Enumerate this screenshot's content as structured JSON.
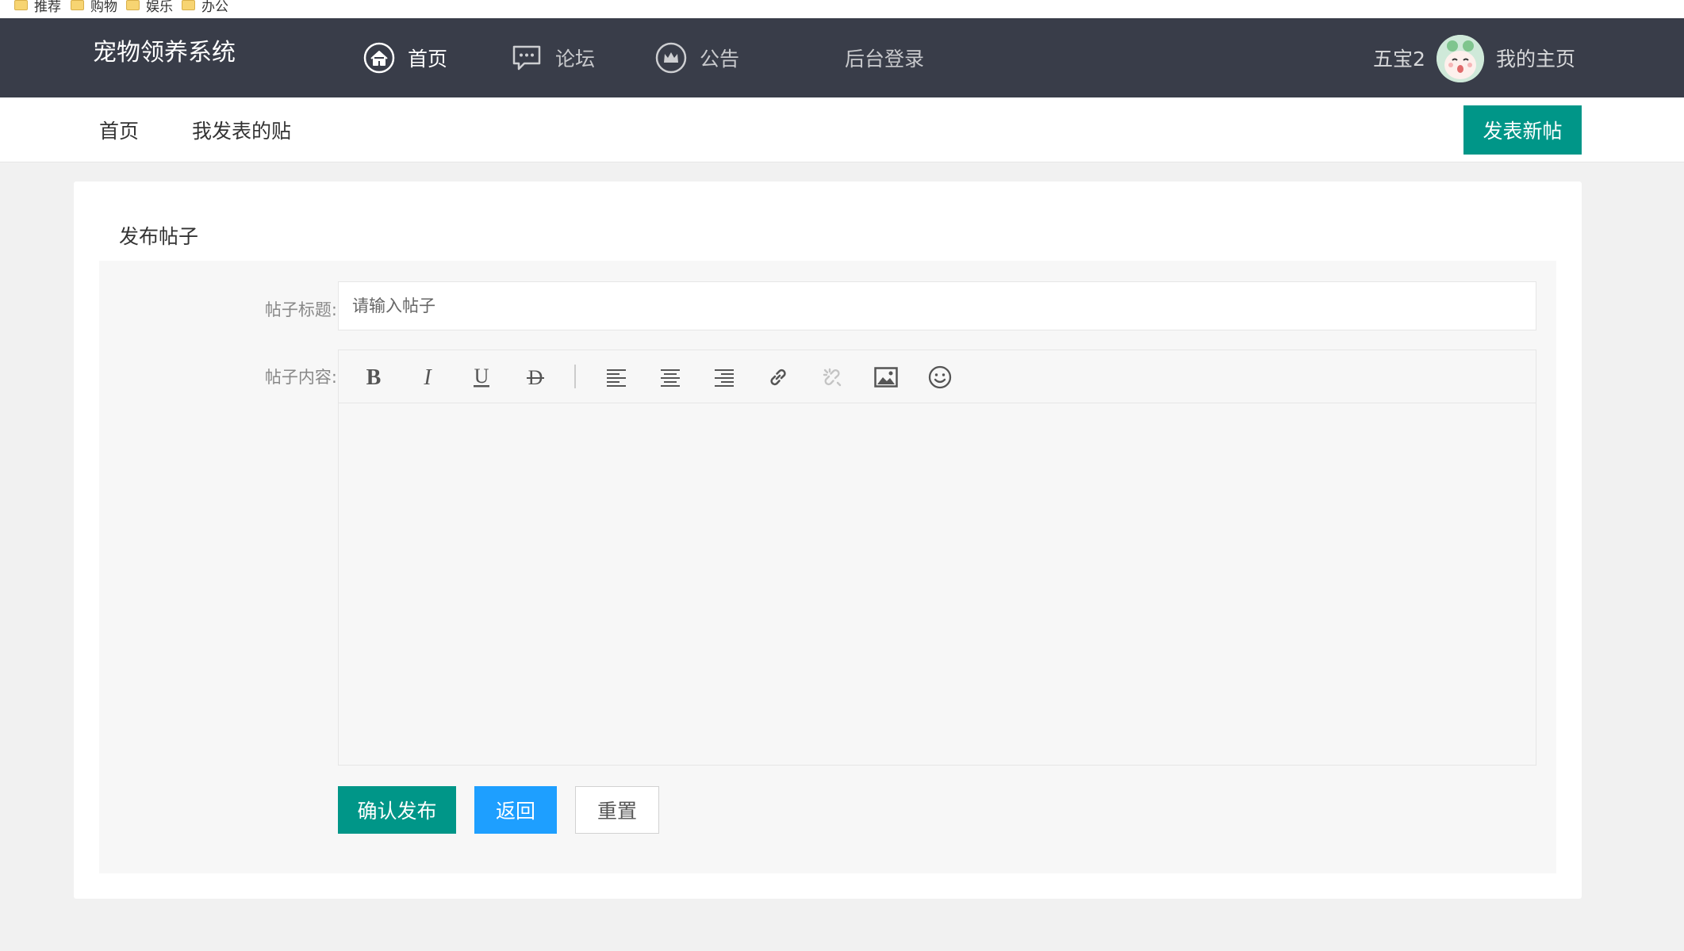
{
  "bookmarks": [
    "推荐",
    "购物",
    "娱乐",
    "办公"
  ],
  "header": {
    "logo": "宠物领养系统",
    "nav": [
      {
        "label": "首页",
        "icon": "home-icon"
      },
      {
        "label": "论坛",
        "icon": "chat-icon"
      },
      {
        "label": "公告",
        "icon": "crown-icon"
      },
      {
        "label": "后台登录"
      }
    ],
    "user_name": "五宝2",
    "my_home": "我的主页"
  },
  "subnav": {
    "items": [
      "首页",
      "我发表的贴"
    ],
    "new_post": "发表新帖"
  },
  "form": {
    "card_title": "发布帖子",
    "title_label": "帖子标题:",
    "title_placeholder": "请输入帖子",
    "content_label": "帖子内容:",
    "toolbar": [
      "bold-icon",
      "italic-icon",
      "underline-icon",
      "strikethrough-icon",
      "align-left-icon",
      "align-center-icon",
      "align-right-icon",
      "link-icon",
      "unlink-icon",
      "image-icon",
      "emoji-icon"
    ],
    "confirm": "确认发布",
    "back": "返回",
    "reset": "重置"
  },
  "colors": {
    "header_bg": "#393d49",
    "primary": "#009688",
    "blue": "#1e9fff"
  }
}
